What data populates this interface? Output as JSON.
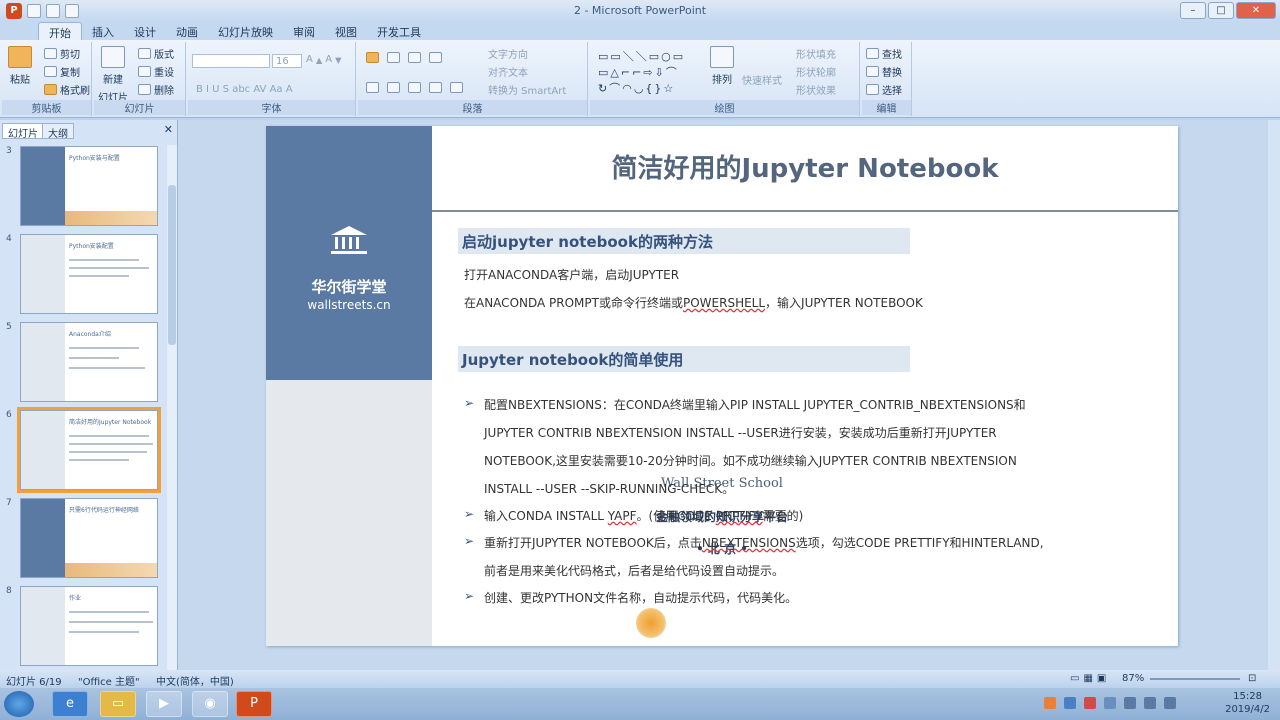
{
  "window": {
    "title": "2 - Microsoft PowerPoint"
  },
  "tabs": [
    "开始",
    "插入",
    "设计",
    "动画",
    "幻灯片放映",
    "审阅",
    "视图",
    "开发工具"
  ],
  "ribbon": {
    "clipboard": {
      "label": "剪贴板",
      "paste": "粘贴",
      "cut": "剪切",
      "copy": "复制",
      "format_painter": "格式刷"
    },
    "slides": {
      "label": "幻灯片",
      "new_slide": "新建",
      "new_slide2": "幻灯片",
      "layout": "版式",
      "reset": "重设",
      "delete": "删除"
    },
    "font": {
      "label": "字体",
      "size": "16"
    },
    "paragraph": {
      "label": "段落",
      "text_direction": "文字方向",
      "align_text": "对齐文本",
      "smartart": "转换为 SmartArt"
    },
    "drawing": {
      "label": "绘图",
      "arrange": "排列",
      "quick_styles": "快速样式",
      "fill": "形状填充",
      "outline": "形状轮廓",
      "effects": "形状效果"
    },
    "editing": {
      "label": "编辑",
      "find": "查找",
      "replace": "替换",
      "select": "选择"
    }
  },
  "sidebar": {
    "tab_slides": "幻灯片",
    "tab_outline": "大纲",
    "thumbs": [
      {
        "num": "3",
        "title": "Python安装与配置"
      },
      {
        "num": "4",
        "title": "Python安装配置"
      },
      {
        "num": "5",
        "title": "Anaconda介绍"
      },
      {
        "num": "6",
        "title": "简洁好用的Jupyter Notebook"
      },
      {
        "num": "7",
        "title": "只需6行代码运行神经网络"
      },
      {
        "num": "8",
        "title": "作业"
      }
    ]
  },
  "slide": {
    "brand_name": "华尔街学堂",
    "brand_url": "wallstreets.cn",
    "school": "Wall Street School",
    "tagline": "金融领域的知识分享平台",
    "city": "• 北 京 •",
    "title": "简洁好用的Jupyter Notebook",
    "sec1": "启动jupyter notebook的两种方法",
    "s1_l1": "打开ANACONDA客户端，启动JUPYTER",
    "s1_l2a": "在ANACONDA PROMPT或命令行终端或",
    "s1_l2b": "POWERSHELL",
    "s1_l2c": "，输入JUPYTER NOTEBOOK",
    "sec2": "Jupyter notebook的简单使用",
    "b1_l1": "配置NBEXTENSIONS：在CONDA终端里输入PIP INSTALL JUPYTER_CONTRIB_NBEXTENSIONS和",
    "b1_l2": "JUPYTER CONTRIB NBEXTENSION INSTALL --USER进行安装，安装成功后重新打开JUPYTER",
    "b1_l3": "NOTEBOOK,这里安装需要10-20分钟时间。如不成功继续输入JUPYTER CONTRIB NBEXTENSION",
    "b1_l4": "INSTALL --USER --SKIP-RUNNING-CHECK。",
    "b2_a": "输入CONDA INSTALL ",
    "b2_b": "YAPF",
    "b2_c": "。(使用CODE ",
    "b2_d": "PRTTIFY",
    "b2_e": "需要的)",
    "b3_a": "重新打开JUPYTER NOTEBOOK后，点击",
    "b3_b": "NBEXTENSIONS",
    "b3_c": "选项，勾选CODE PRETTIFY和HINTERLAND,",
    "b3_l2": "前者是用来美化代码格式，后者是给代码设置自动提示。",
    "b4": "创建、更改PYTHON文件名称，自动提示代码，代码美化。",
    "bullet_glyph": "➢"
  },
  "status": {
    "slide_no": "幻灯片 6/19",
    "theme": "\"Office 主题\"",
    "lang": "中文(简体，中国)",
    "zoom": "87%"
  },
  "taskbar": {
    "time": "15:28",
    "date": "2019/4/2"
  }
}
